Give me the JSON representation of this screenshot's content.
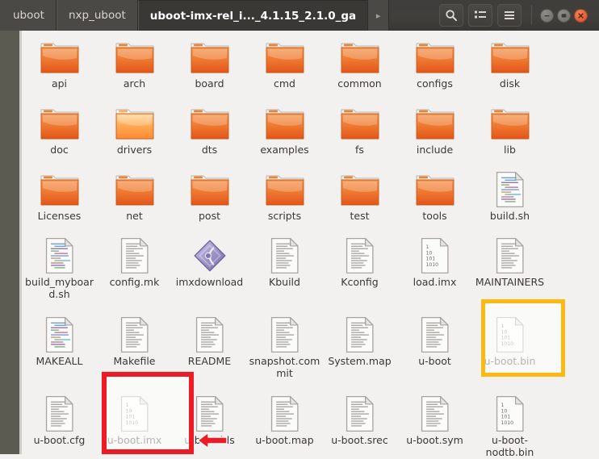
{
  "window": {
    "breadcrumb": [
      {
        "label": "uboot",
        "active": false
      },
      {
        "label": "nxp_uboot",
        "active": false
      },
      {
        "label": "uboot-imx-rel_i..._4.1.15_2.1.0_ga",
        "active": true
      }
    ],
    "breadcrumb_next_arrow": "▸",
    "toolbar": [
      {
        "name": "search-button",
        "icon": "search-icon"
      },
      {
        "name": "view-options-button",
        "icon": "list-view-icon"
      },
      {
        "name": "menu-button",
        "icon": "hamburger-menu-icon"
      }
    ],
    "controls": [
      {
        "name": "minimize-button",
        "icon": "minimize-icon",
        "glyph": "–"
      },
      {
        "name": "maximize-button",
        "icon": "maximize-icon",
        "glyph": "□"
      },
      {
        "name": "close-button",
        "icon": "close-icon",
        "glyph": "×"
      }
    ],
    "colors": {
      "titlebar": "#413f3c",
      "sidebar": "#5c5b51",
      "content_bg": "#f2f1f0",
      "folder_orange": "#e8641c",
      "highlight_yellow": "#fcb813",
      "highlight_red": "#ee1b24",
      "close_button": "#da4b22"
    }
  },
  "annotations": [
    {
      "name": "yellow-highlight-u-boot-bin",
      "target": "u-boot.bin",
      "color": "#fcb813",
      "shape": "rectangle"
    },
    {
      "name": "red-highlight-u-boot-imx",
      "target": "u-boot.imx",
      "color": "#ee1b24",
      "shape": "rectangle"
    },
    {
      "name": "red-arrow-pointing-left",
      "target": "u-boot.imx",
      "color": "#ee1b24",
      "shape": "arrow-left"
    }
  ],
  "files": [
    {
      "name": "api",
      "type": "folder"
    },
    {
      "name": "arch",
      "type": "folder"
    },
    {
      "name": "board",
      "type": "folder"
    },
    {
      "name": "cmd",
      "type": "folder"
    },
    {
      "name": "common",
      "type": "folder"
    },
    {
      "name": "configs",
      "type": "folder"
    },
    {
      "name": "disk",
      "type": "folder"
    },
    {
      "name": "doc",
      "type": "folder"
    },
    {
      "name": "drivers",
      "type": "folder",
      "state": "hover"
    },
    {
      "name": "dts",
      "type": "folder"
    },
    {
      "name": "examples",
      "type": "folder"
    },
    {
      "name": "fs",
      "type": "folder"
    },
    {
      "name": "include",
      "type": "folder"
    },
    {
      "name": "lib",
      "type": "folder"
    },
    {
      "name": "Licenses",
      "type": "folder"
    },
    {
      "name": "net",
      "type": "folder"
    },
    {
      "name": "post",
      "type": "folder"
    },
    {
      "name": "scripts",
      "type": "folder"
    },
    {
      "name": "test",
      "type": "folder"
    },
    {
      "name": "tools",
      "type": "folder"
    },
    {
      "name": "build.sh",
      "type": "script"
    },
    {
      "name": "build_myboard.sh",
      "type": "script"
    },
    {
      "name": "config.mk",
      "type": "text"
    },
    {
      "name": "imxdownload",
      "type": "executable"
    },
    {
      "name": "Kbuild",
      "type": "text"
    },
    {
      "name": "Kconfig",
      "type": "text"
    },
    {
      "name": "load.imx",
      "type": "binary"
    },
    {
      "name": "MAINTAINERS",
      "type": "text"
    },
    {
      "name": "MAKEALL",
      "type": "script"
    },
    {
      "name": "Makefile",
      "type": "text"
    },
    {
      "name": "README",
      "type": "text"
    },
    {
      "name": "snapshot.commit",
      "type": "text"
    },
    {
      "name": "System.map",
      "type": "text"
    },
    {
      "name": "u-boot",
      "type": "text"
    },
    {
      "name": "u-boot.bin",
      "type": "binary",
      "highlight": "yellow"
    },
    {
      "name": "u-boot.cfg",
      "type": "text"
    },
    {
      "name": "u-boot.imx",
      "type": "binary",
      "highlight": "red"
    },
    {
      "name": "u-boot.lds",
      "type": "text"
    },
    {
      "name": "u-boot.map",
      "type": "text"
    },
    {
      "name": "u-boot.srec",
      "type": "text"
    },
    {
      "name": "u-boot.sym",
      "type": "text"
    },
    {
      "name": "u-boot-nodtb.bin",
      "type": "binary"
    }
  ],
  "binary_icon_lines": [
    "1",
    "10",
    "101",
    "1010"
  ]
}
